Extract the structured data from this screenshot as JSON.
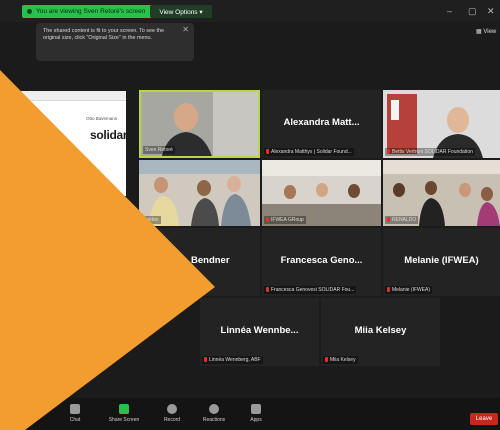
{
  "titlebar": {
    "viewing_text": "You are viewing Sven Retoré's screen",
    "view_options_label": "View Options ▾",
    "controls": [
      "–",
      "▢",
      "✕"
    ]
  },
  "tooltip": {
    "text": "The shared content is fit to your screen. To see the original size, click \"Original Size\" in the menu.",
    "close_icon": "✕"
  },
  "view_button": "View",
  "shared_screen": {
    "toolbar_text": "Otto Bavemann",
    "logo_text": "solidar"
  },
  "participants": [
    {
      "id": "sven",
      "label": "Sven Retoré"
    },
    {
      "id": "alexandra",
      "display_name": "Alexandra Matt...",
      "label": "Alexandra Matthys | Solidar Found..."
    },
    {
      "id": "bettis",
      "label": "Bettis Vertroni SOLIDAR Foundation"
    },
    {
      "id": "saldan",
      "label": "Saldan"
    },
    {
      "id": "ifwea-group",
      "label": "IFWEA GRoup"
    },
    {
      "id": "renaldo",
      "label": "RENALDO"
    },
    {
      "id": "bendner",
      "display_name": "Bendner"
    },
    {
      "id": "francesca",
      "display_name": "Francesca Geno...",
      "label": "Francesca Genovesi SOLIDAR Fou..."
    },
    {
      "id": "melanie",
      "display_name": "Melanie (IFWEA)",
      "label": "Melanie (IFWEA)"
    },
    {
      "id": "linnea",
      "display_name": "Linnéa Wennbe...",
      "label": "Linnéa Wennberg, ABF"
    },
    {
      "id": "miia",
      "display_name": "Miia Kelsey",
      "label": "Miia Kelsey"
    }
  ],
  "bottombar": {
    "items": [
      "Chat",
      "Share Screen",
      "Record",
      "Reactions",
      "Apps"
    ],
    "leave_label": "Leave"
  },
  "colors": {
    "accent_green": "#27c24c",
    "orange_overlay": "#f39c2f",
    "leave_red": "#c7281e"
  }
}
